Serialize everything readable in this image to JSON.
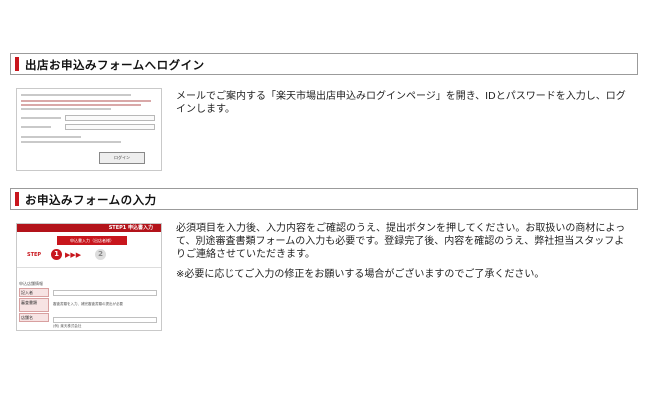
{
  "sections": [
    {
      "title": "出店お申込みフォームへログイン",
      "description": "メールでご案内する「楽天市場出店申込みログインページ」を開き、IDとパスワードを入力し、ログインします。"
    },
    {
      "title": "お申込みフォームの入力",
      "description": "必須項目を入力後、入力内容をご確認のうえ、提出ボタンを押してください。お取扱いの商材によって、別途審査書類フォームの入力も必要です。登録完了後、内容を確認のうえ、弊社担当スタッフよりご連絡させていただきます。",
      "note": "※必要に応じてご入力の修正をお願いする場合がございますのでご了承ください。"
    }
  ],
  "thumb1": {
    "login_button": "ログイン"
  },
  "thumb2": {
    "header": "STEP1 申込書入力",
    "tab": "申込書入力（出店者様）",
    "step_label": "STEP",
    "step1": "1",
    "step2": "2",
    "form_header": "申込店舗情報",
    "label1": "記入者",
    "label2": "審査書類",
    "label3": "店舗名",
    "field2_text": "審査書類を入力、補完審査書類の提出が必要",
    "field3_text": "(例) 楽天株式会社"
  },
  "colors": {
    "accent": "#c8161d",
    "header_border": "#9b9b9b"
  }
}
